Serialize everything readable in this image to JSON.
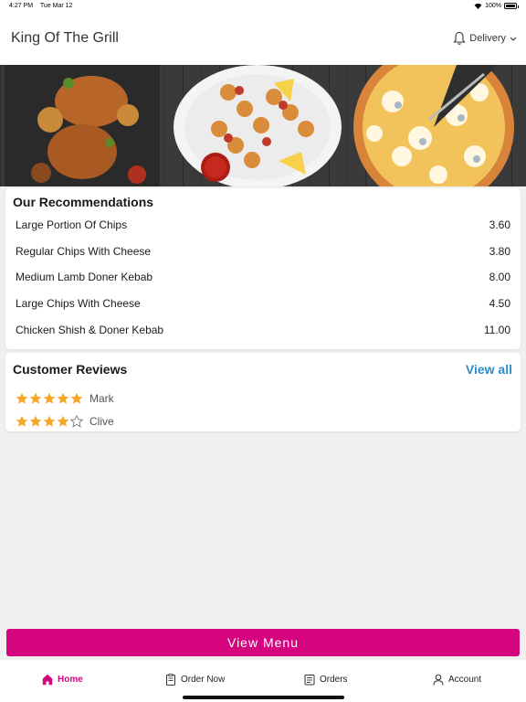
{
  "status_bar": {
    "time": "4:27 PM",
    "date": "Tue Mar 12",
    "battery": "100%"
  },
  "header": {
    "title": "King Of The Grill",
    "delivery_label": "Delivery"
  },
  "recommendations": {
    "title": "Our Recommendations",
    "items": [
      {
        "name": "Large Portion Of Chips",
        "price": "3.60"
      },
      {
        "name": "Regular Chips With Cheese",
        "price": "3.80"
      },
      {
        "name": "Medium Lamb Doner Kebab",
        "price": "8.00"
      },
      {
        "name": "Large Chips With Cheese",
        "price": "4.50"
      },
      {
        "name": "Chicken Shish & Doner Kebab",
        "price": "11.00"
      }
    ]
  },
  "reviews": {
    "title": "Customer Reviews",
    "view_all": "View all",
    "items": [
      {
        "name": "Mark",
        "rating": 5
      },
      {
        "name": "Clive",
        "rating": 4
      }
    ]
  },
  "view_menu_label": "View Menu",
  "nav": {
    "home": "Home",
    "order_now": "Order Now",
    "orders": "Orders",
    "account": "Account"
  },
  "colors": {
    "accent": "#d4057f",
    "link": "#2a8fc7",
    "star": "#f5a623"
  }
}
